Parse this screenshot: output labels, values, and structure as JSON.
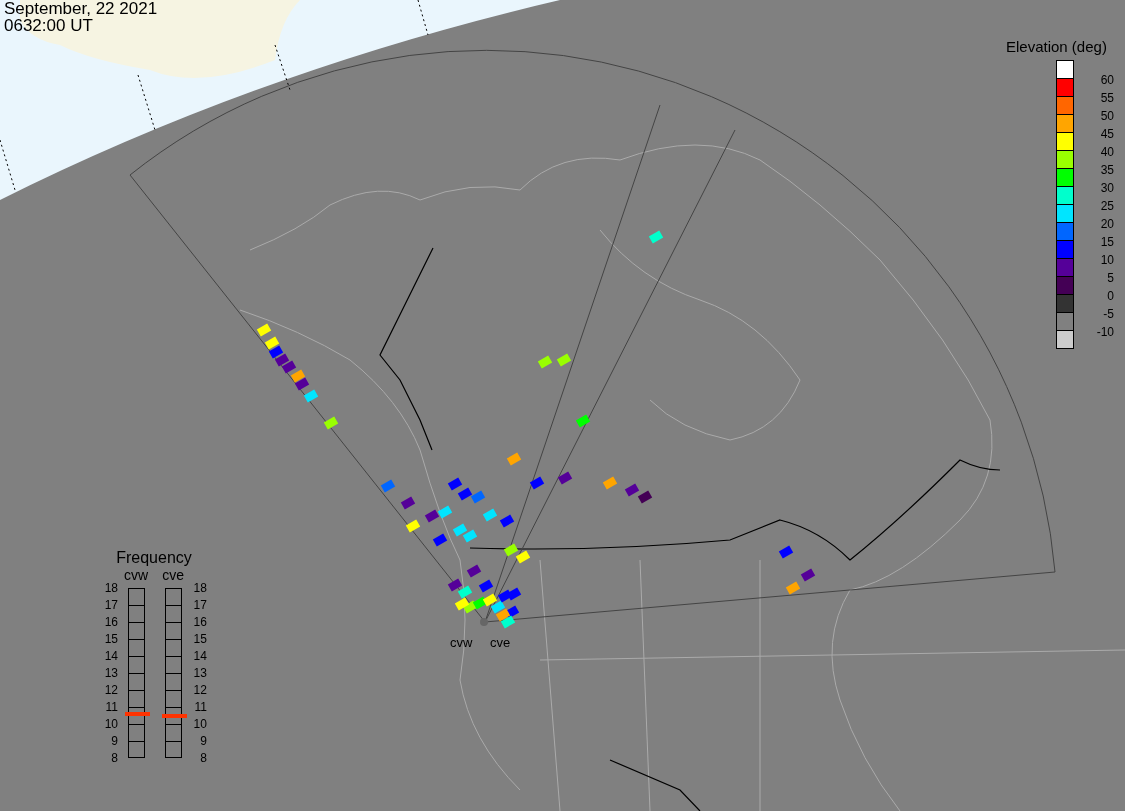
{
  "title": {
    "date": "September, 22 2021",
    "time": "0632:00 UT"
  },
  "elevation_legend": {
    "title": "Elevation (deg)",
    "colors": [
      {
        "color": "#ffffff"
      },
      {
        "color": "#ff0000"
      },
      {
        "color": "#ff6600"
      },
      {
        "color": "#ffa500"
      },
      {
        "color": "#ffff00"
      },
      {
        "color": "#99ff00"
      },
      {
        "color": "#00ff00"
      },
      {
        "color": "#00ffcc"
      },
      {
        "color": "#00e5ff"
      },
      {
        "color": "#0066ff"
      },
      {
        "color": "#0000ff"
      },
      {
        "color": "#550099"
      },
      {
        "color": "#440055"
      },
      {
        "color": "#333333"
      },
      {
        "color": "#808080"
      },
      {
        "color": "#cccccc"
      }
    ],
    "labels": [
      "60",
      "55",
      "50",
      "45",
      "40",
      "35",
      "30",
      "25",
      "20",
      "15",
      "10",
      "5",
      "0",
      "-5",
      "-10"
    ]
  },
  "frequency": {
    "title": "Frequency",
    "radars": [
      {
        "name": "cvw",
        "level": 0.255,
        "ticks": [
          "18",
          "17",
          "16",
          "15",
          "14",
          "13",
          "12",
          "11",
          "10",
          "9",
          "8"
        ]
      },
      {
        "name": "cve",
        "level": 0.245,
        "ticks": [
          "18",
          "17",
          "16",
          "15",
          "14",
          "13",
          "12",
          "11",
          "10",
          "9",
          "8"
        ]
      }
    ]
  },
  "radar_sites": [
    {
      "name": "cvw"
    },
    {
      "name": "cve"
    }
  ]
}
